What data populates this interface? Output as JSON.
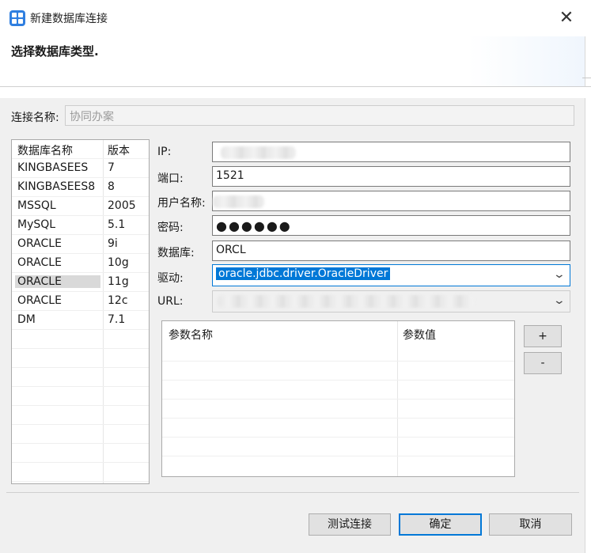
{
  "window": {
    "title": "新建数据库连接",
    "close_glyph": "✕"
  },
  "banner": {
    "title": "选择数据库类型."
  },
  "connection": {
    "name_label": "连接名称:",
    "name_placeholder": "协同办案"
  },
  "db_table": {
    "headers": [
      "数据库名称",
      "版本"
    ],
    "rows": [
      {
        "name": "KINGBASEES",
        "version": "7"
      },
      {
        "name": "KINGBASEES8",
        "version": "8"
      },
      {
        "name": "MSSQL",
        "version": "2005"
      },
      {
        "name": "MySQL",
        "version": "5.1"
      },
      {
        "name": "ORACLE",
        "version": "9i"
      },
      {
        "name": "ORACLE",
        "version": "10g"
      },
      {
        "name": "ORACLE",
        "version": "11g"
      },
      {
        "name": "ORACLE",
        "version": "12c"
      },
      {
        "name": "DM",
        "version": "7.1"
      }
    ],
    "selected_index": 6
  },
  "form": {
    "ip_label": "IP:",
    "port_label": "端口:",
    "port_value": "1521",
    "user_label": "用户名称:",
    "password_label": "密码:",
    "password_value": "●●●●●●",
    "database_label": "数据库:",
    "database_value": "ORCL",
    "driver_label": "驱动:",
    "driver_value": "oracle.jdbc.driver.OracleDriver",
    "url_label": "URL:"
  },
  "params": {
    "headers": [
      "参数名称",
      "参数值"
    ],
    "add_label": "+",
    "remove_label": "-"
  },
  "buttons": {
    "test": "测试连接",
    "ok": "确定",
    "cancel": "取消"
  },
  "colors": {
    "accent": "#0078d7",
    "icon_blue": "#2f7fe0"
  },
  "icons": {
    "app": "database-app-icon",
    "close": "close-icon",
    "dropdown": "chevron-down-icon"
  }
}
